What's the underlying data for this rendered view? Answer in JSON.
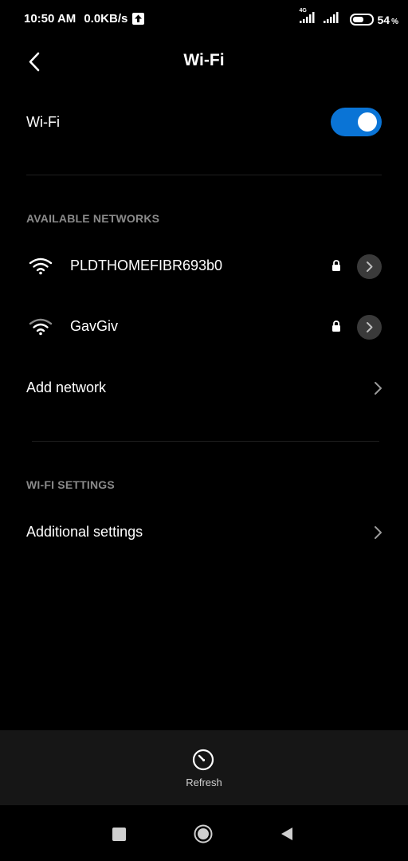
{
  "status_bar": {
    "time": "10:50 AM",
    "speed": "0.0KB/s",
    "network_type": "4G",
    "battery_level": "54",
    "battery_unit": "%"
  },
  "header": {
    "title": "Wi-Fi"
  },
  "wifi_toggle": {
    "label": "Wi-Fi",
    "enabled": true,
    "accent_color": "#0a74d6"
  },
  "available_networks": {
    "section_title": "AVAILABLE NETWORKS",
    "networks": [
      {
        "name": "PLDTHOMEFIBR693b0",
        "secured": true,
        "signal_icon": "wifi-signal-icon"
      },
      {
        "name": "GavGiv",
        "secured": true,
        "signal_icon": "wifi-signal-icon"
      }
    ],
    "add_network_label": "Add network"
  },
  "wifi_settings": {
    "section_title": "WI-FI SETTINGS",
    "additional_settings_label": "Additional settings"
  },
  "action_bar": {
    "refresh_label": "Refresh"
  },
  "icons": {
    "back": "back-arrow-icon",
    "lock": "lock-icon",
    "chevron": "chevron-right-icon",
    "refresh": "refresh-icon",
    "nav_recents": "recents-square-icon",
    "nav_home": "home-circle-icon",
    "nav_back": "back-triangle-icon"
  }
}
